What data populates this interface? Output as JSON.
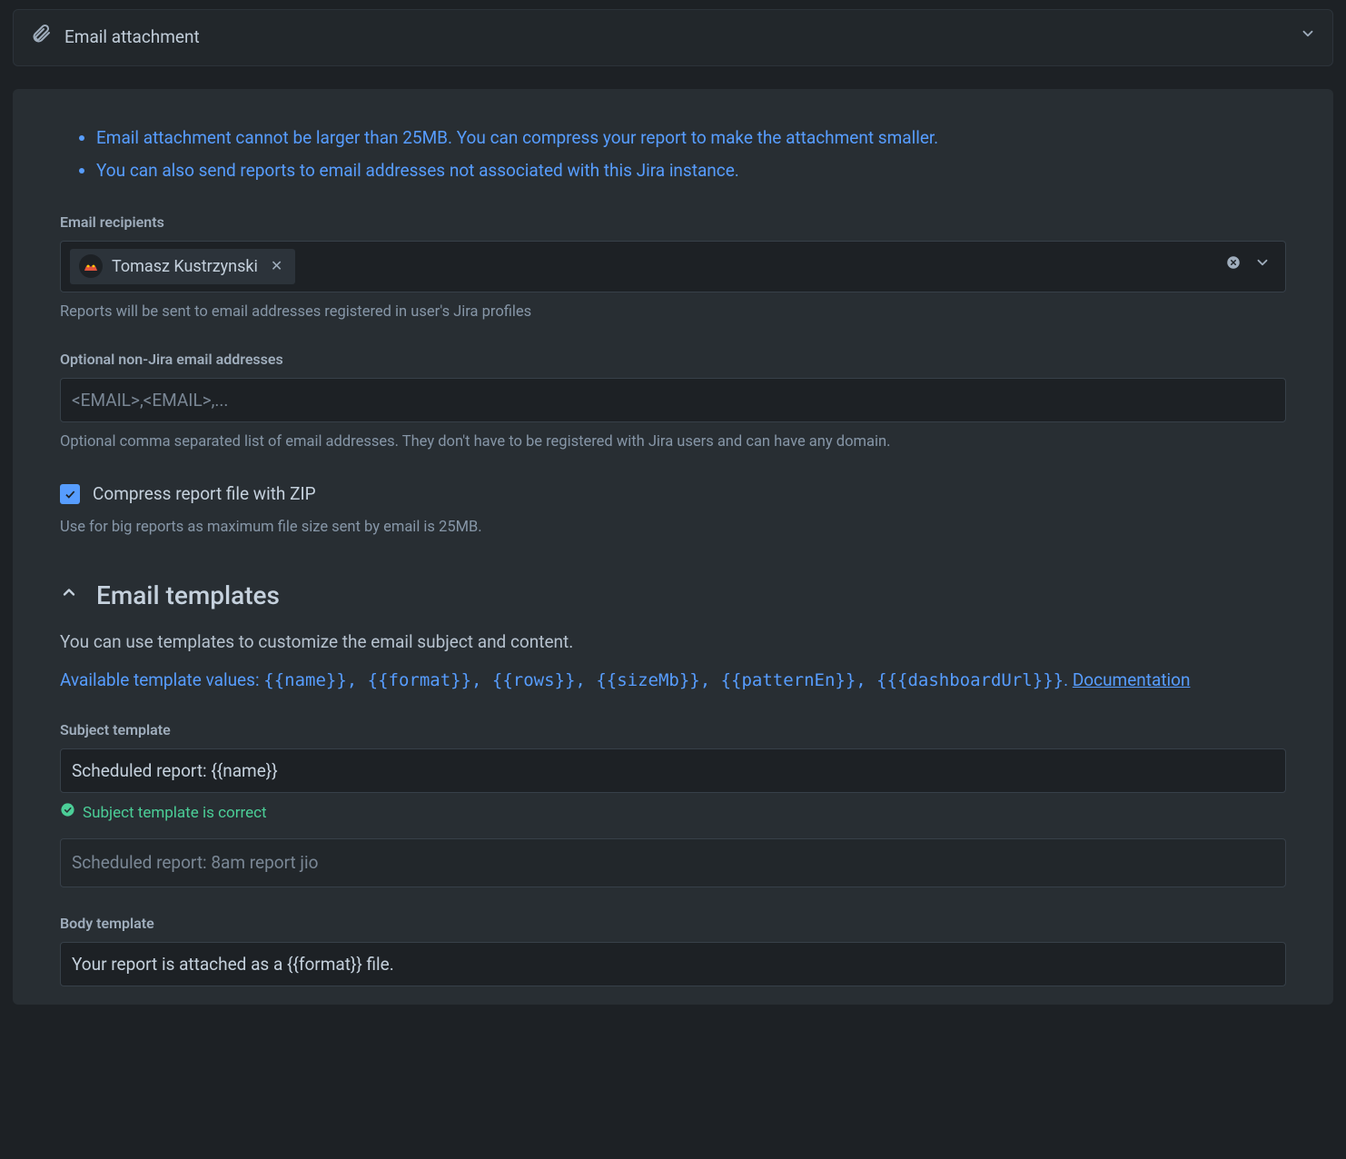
{
  "header": {
    "title": "Email attachment"
  },
  "notes": [
    "Email attachment cannot be larger than 25MB. You can compress your report to make the attachment smaller.",
    "You can also send reports to email addresses not associated with this Jira instance."
  ],
  "recipients": {
    "label": "Email recipients",
    "chip_name": "Tomasz Kustrzynski",
    "help": "Reports will be sent to email addresses registered in user's Jira profiles"
  },
  "nonjira": {
    "label": "Optional non-Jira email addresses",
    "placeholder": "<EMAIL>,<EMAIL>,...",
    "help": "Optional comma separated list of email addresses. They don't have to be registered with Jira users and can have any domain."
  },
  "compress": {
    "label": "Compress report file with ZIP",
    "help": "Use for big reports as maximum file size sent by email is 25MB."
  },
  "templates": {
    "heading": "Email templates",
    "desc": "You can use templates to customize the email subject and content.",
    "avail_prefix": "Available template values: ",
    "values": "{{name}}, {{format}}, {{rows}}, {{sizeMb}}, {{patternEn}}, {{{dashboardUrl}}}",
    "avail_suffix": ". ",
    "doc_link": "Documentation"
  },
  "subject": {
    "label": "Subject template",
    "value": "Scheduled report: {{name}}",
    "validation_prefix": "Subject template",
    "validation_suffix": " is correct",
    "preview": "Scheduled report: 8am report jio"
  },
  "body": {
    "label": "Body template",
    "value": "Your report is attached as a {{format}} file."
  }
}
